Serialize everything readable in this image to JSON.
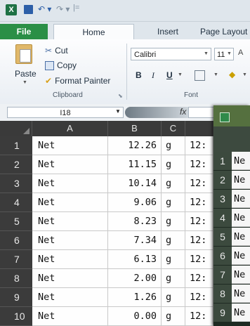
{
  "quick_access": {
    "app_icon": "X",
    "undo_icon": "undo-icon",
    "redo_icon": "redo-icon",
    "more": "|="
  },
  "tabs": [
    {
      "label": "File"
    },
    {
      "label": "Home"
    },
    {
      "label": "Insert"
    },
    {
      "label": "Page Layout"
    }
  ],
  "clipboard": {
    "paste": "Paste",
    "cut": "Cut",
    "copy": "Copy",
    "format_painter": "Format Painter",
    "group_label": "Clipboard"
  },
  "font": {
    "name": "Calibri",
    "size": "11",
    "grow": "A",
    "bold": "B",
    "italic": "I",
    "underline": "U",
    "group_label": "Font"
  },
  "formula_bar": {
    "name_box": "I18",
    "fx": "fx",
    "value": ""
  },
  "columns": [
    "A",
    "B",
    "C"
  ],
  "rows": [
    {
      "num": "1",
      "a": "Net",
      "b": "12.26",
      "c": "g",
      "d": "12:"
    },
    {
      "num": "2",
      "a": "Net",
      "b": "11.15",
      "c": "g",
      "d": "12:"
    },
    {
      "num": "3",
      "a": "Net",
      "b": "10.14",
      "c": "g",
      "d": "12:"
    },
    {
      "num": "4",
      "a": "Net",
      "b": "9.06",
      "c": "g",
      "d": "12:"
    },
    {
      "num": "5",
      "a": "Net",
      "b": "8.23",
      "c": "g",
      "d": "12:"
    },
    {
      "num": "6",
      "a": "Net",
      "b": "7.34",
      "c": "g",
      "d": "12:"
    },
    {
      "num": "7",
      "a": "Net",
      "b": "6.13",
      "c": "g",
      "d": "12:"
    },
    {
      "num": "8",
      "a": "Net",
      "b": "2.00",
      "c": "g",
      "d": "12:"
    },
    {
      "num": "9",
      "a": "Net",
      "b": "1.26",
      "c": "g",
      "d": "12:"
    },
    {
      "num": "10",
      "a": "Net",
      "b": "0.00",
      "c": "g",
      "d": "12:"
    }
  ],
  "second_window": {
    "rows": [
      {
        "num": "1",
        "a": "Ne"
      },
      {
        "num": "2",
        "a": "Ne"
      },
      {
        "num": "3",
        "a": "Ne"
      },
      {
        "num": "4",
        "a": "Ne"
      },
      {
        "num": "5",
        "a": "Ne"
      },
      {
        "num": "6",
        "a": "Ne"
      },
      {
        "num": "7",
        "a": "Ne"
      },
      {
        "num": "8",
        "a": "Ne"
      },
      {
        "num": "9",
        "a": "Ne"
      }
    ]
  }
}
